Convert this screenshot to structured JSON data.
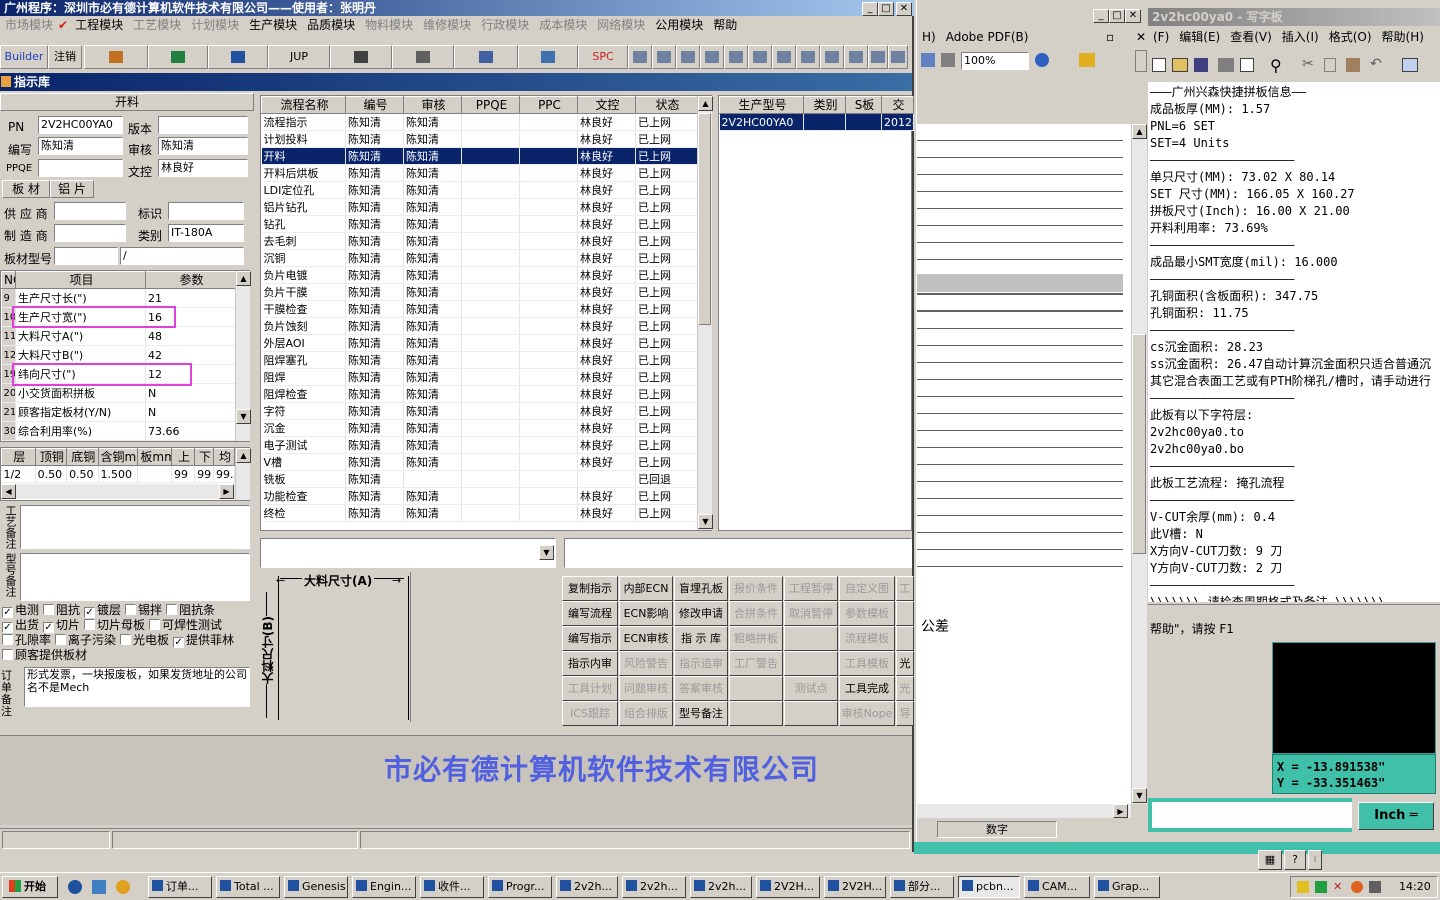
{
  "main": {
    "title": "广州程序：深圳市必有德计算机软件技术有限公司——使用者：张明丹",
    "menu": [
      "市场模块",
      "工程模块",
      "工艺模块",
      "计划模块",
      "生产模块",
      "品质模块",
      "物料模块",
      "维修模块",
      "行政模块",
      "成本模块",
      "网络模块",
      "公用模块",
      "帮助"
    ],
    "toolbar": [
      "Builder",
      "注销",
      "JUP",
      "SPC"
    ],
    "sub_title": "指示库"
  },
  "left": {
    "header": "开料",
    "pn_label": "PN",
    "pn": "2V2HC00YA0",
    "ver_label": "版本",
    "ver": "",
    "edit_label": "编写",
    "edit": "陈知清",
    "review_label": "审核",
    "review": "陈知清",
    "ppqe_label": "PPQE",
    "ppqe": "",
    "doc_label": "文控",
    "doc": "林良好",
    "tab1": "板 材",
    "tab2": "铝 片",
    "supplier_label": "供 应 商",
    "supplier": "",
    "mark_label": "标识",
    "mark": "",
    "maker_label": "制 造 商",
    "maker": "",
    "type_label": "类别",
    "type": "IT-180A",
    "model_label": "板材型号",
    "model": "",
    "model2": "/",
    "param_head": [
      "NO",
      "项目",
      "参数"
    ],
    "params": [
      [
        "9",
        "生产尺寸长(\")",
        "21"
      ],
      [
        "10",
        "生产尺寸宽(\")",
        "16"
      ],
      [
        "11",
        "大料尺寸A(\")",
        "48"
      ],
      [
        "12",
        "大料尺寸B(\")",
        "42"
      ],
      [
        "19",
        "纬向尺寸(\")",
        "12"
      ],
      [
        "20",
        "小交货面积拼板",
        "N"
      ],
      [
        "21",
        "顾客指定板材(Y/N)",
        "N"
      ],
      [
        "30",
        "综合利用率(%)",
        "73.66"
      ]
    ],
    "layer_head": [
      "层",
      "顶铜",
      "底铜",
      "含铜mm",
      "板mm",
      "上",
      "下",
      "均"
    ],
    "layer_row": [
      "1/2",
      "0.50",
      "0.50",
      "1.500",
      "",
      "99",
      "99",
      "99."
    ],
    "note_label1": "工艺备注",
    "note_label2": "型号备注",
    "checks": [
      [
        "电测",
        true
      ],
      [
        "阻抗",
        false
      ],
      [
        "镀层",
        true
      ],
      [
        "锡拌",
        false
      ],
      [
        "阻抗条",
        false
      ],
      [
        "出货",
        true
      ],
      [
        "切片",
        true
      ],
      [
        "切片母板",
        false
      ],
      [
        "可焊性测试",
        false
      ],
      [
        "孔隙率",
        false
      ],
      [
        "离子污染",
        false
      ],
      [
        "光电板",
        false
      ],
      [
        "提供菲林",
        true
      ],
      [
        "顾客提供板材",
        false
      ]
    ],
    "order_label": "订单备注",
    "order_note": "形式发票，一块报废板，如果发货地址的公司名不是Mech"
  },
  "flow": {
    "head": [
      "流程名称",
      "编号",
      "审核",
      "PPQE",
      "PPC",
      "文控",
      "状态"
    ],
    "rows": [
      [
        "流程指示",
        "陈知清",
        "陈知清",
        "",
        "",
        "林良好",
        "已上网"
      ],
      [
        "计划投料",
        "陈知清",
        "陈知清",
        "",
        "",
        "林良好",
        "已上网"
      ],
      [
        "开料",
        "陈知清",
        "陈知清",
        "",
        "",
        "林良好",
        "已上网"
      ],
      [
        "开料后烘板",
        "陈知清",
        "陈知清",
        "",
        "",
        "林良好",
        "已上网"
      ],
      [
        "LDI定位孔",
        "陈知清",
        "陈知清",
        "",
        "",
        "林良好",
        "已上网"
      ],
      [
        "铝片钻孔",
        "陈知清",
        "陈知清",
        "",
        "",
        "林良好",
        "已上网"
      ],
      [
        "钻孔",
        "陈知清",
        "陈知清",
        "",
        "",
        "林良好",
        "已上网"
      ],
      [
        "去毛刺",
        "陈知清",
        "陈知清",
        "",
        "",
        "林良好",
        "已上网"
      ],
      [
        "沉铜",
        "陈知清",
        "陈知清",
        "",
        "",
        "林良好",
        "已上网"
      ],
      [
        "负片电镀",
        "陈知清",
        "陈知清",
        "",
        "",
        "林良好",
        "已上网"
      ],
      [
        "负片干膜",
        "陈知清",
        "陈知清",
        "",
        "",
        "林良好",
        "已上网"
      ],
      [
        "干膜检查",
        "陈知清",
        "陈知清",
        "",
        "",
        "林良好",
        "已上网"
      ],
      [
        "负片蚀刻",
        "陈知清",
        "陈知清",
        "",
        "",
        "林良好",
        "已上网"
      ],
      [
        "外层AOI",
        "陈知清",
        "陈知清",
        "",
        "",
        "林良好",
        "已上网"
      ],
      [
        "阻焊塞孔",
        "陈知清",
        "陈知清",
        "",
        "",
        "林良好",
        "已上网"
      ],
      [
        "阻焊",
        "陈知清",
        "陈知清",
        "",
        "",
        "林良好",
        "已上网"
      ],
      [
        "阻焊检查",
        "陈知清",
        "陈知清",
        "",
        "",
        "林良好",
        "已上网"
      ],
      [
        "字符",
        "陈知清",
        "陈知清",
        "",
        "",
        "林良好",
        "已上网"
      ],
      [
        "沉金",
        "陈知清",
        "陈知清",
        "",
        "",
        "林良好",
        "已上网"
      ],
      [
        "电子测试",
        "陈知清",
        "陈知清",
        "",
        "",
        "林良好",
        "已上网"
      ],
      [
        "V槽",
        "陈知清",
        "陈知清",
        "",
        "",
        "林良好",
        "已上网"
      ],
      [
        "铣板",
        "陈知清",
        "",
        "",
        "",
        "",
        "已回退"
      ],
      [
        "功能检查",
        "陈知清",
        "陈知清",
        "",
        "",
        "林良好",
        "已上网"
      ],
      [
        "终检",
        "陈知清",
        "陈知清",
        "",
        "",
        "林良好",
        "已上网"
      ]
    ],
    "selected": 2
  },
  "prod": {
    "head": [
      "生产型号",
      "类别",
      "S板",
      "交"
    ],
    "row": [
      "2V2HC00YA0",
      "",
      "",
      "2012-"
    ]
  },
  "diagram": {
    "a": "大料尺寸(A)",
    "b": "大料尺寸(B)"
  },
  "buttons": [
    [
      "复制指示",
      1
    ],
    [
      "内部ECN",
      1
    ],
    [
      "盲埋孔板",
      1
    ],
    [
      "报价条件",
      0
    ],
    [
      "工程暂停",
      0
    ],
    [
      "自定义图",
      0
    ],
    [
      "工",
      0
    ],
    [
      "编写流程",
      1
    ],
    [
      "ECN影响",
      1
    ],
    [
      "修改申请",
      1
    ],
    [
      "合拼条件",
      0
    ],
    [
      "取消暂停",
      0
    ],
    [
      "参数模板",
      0
    ],
    [
      "",
      0
    ],
    [
      "编写指示",
      1
    ],
    [
      "ECN审核",
      1
    ],
    [
      "指 示 库",
      1
    ],
    [
      "粗略拼板",
      0
    ],
    [
      "",
      0
    ],
    [
      "流程模板",
      0
    ],
    [
      "",
      0
    ],
    [
      "指示内审",
      1
    ],
    [
      "风险警告",
      0
    ],
    [
      "指示追审",
      0
    ],
    [
      "工厂警告",
      0
    ],
    [
      "",
      0
    ],
    [
      "工具模板",
      0
    ],
    [
      "光",
      1
    ],
    [
      "工具计划",
      0
    ],
    [
      "问题审核",
      0
    ],
    [
      "答案审核",
      0
    ],
    [
      "",
      0
    ],
    [
      "测试点",
      0
    ],
    [
      "工具完成",
      1
    ],
    [
      "光",
      0
    ],
    [
      "ICS跟踪",
      0
    ],
    [
      "组合排版",
      0
    ],
    [
      "型号备注",
      1
    ],
    [
      "",
      0
    ],
    [
      "",
      0
    ],
    [
      "审核Nope",
      0
    ],
    [
      "导",
      0
    ]
  ],
  "banner": "市必有德计算机软件技术有限公司",
  "adobe": {
    "menu1": "H)",
    "menu2": "Adobe PDF(B)",
    "zoom": "100%",
    "status": "数字",
    "tolerance": "公差"
  },
  "wordpad": {
    "title": "2v2hc00ya0 - 写字板",
    "menu": [
      "(F)",
      "编辑(E)",
      "查看(V)",
      "插入(I)",
      "格式(O)",
      "帮助(H)"
    ],
    "lines": [
      "———广州兴森快捷拼板信息——",
      "成品板厚(MM): 1.57",
      "PNL=6 SET",
      "SET=4 Units",
      "————————————————————",
      "单只尺寸(MM): 73.02 X 80.14",
      "SET 尺寸(MM): 166.05 X 160.27",
      "拼板尺寸(Inch): 16.00 X 21.00",
      "开料利用率: 73.69%",
      "————————————————————",
      "成品最小SMT宽度(mil): 16.000",
      "————————————————————",
      "孔铜面积(含板面积): 347.75",
      "孔铜面积: 11.75",
      "————————————————————",
      "cs沉金面积: 28.23",
      "ss沉金面积: 26.47自动计算沉金面积只适合普通沉",
      "其它混合表面工艺或有PTH阶梯孔/槽时，请手动进行",
      "————————————————————",
      "此板有以下字符层:",
      "2v2hc00ya0.to",
      "2v2hc00ya0.bo",
      "————————————————————",
      "此板工艺流程: 掩孔流程",
      "————————————————————",
      "V-CUT余厚(mm): 0.4",
      "此V槽: N",
      "X方向V-CUT刀数: 9 刀",
      "Y方向V-CUT刀数: 2 刀",
      "————————————————————",
      "\\\\\\\\\\\\\\ 请检查周期格式及备注 \\\\\\\\\\\\\\"
    ],
    "status": "帮助\"，请按 F1"
  },
  "cad": {
    "x": "X = -13.891538\"",
    "y": "Y = -33.351463\"",
    "unit": "Inch"
  },
  "taskbar": {
    "start": "开始",
    "items": [
      "订单...",
      "Total ...",
      "Genesis",
      "Engin...",
      "收件...",
      "Progr...",
      "2v2h...",
      "2v2h...",
      "2v2h...",
      "2V2H...",
      "2V2H...",
      "部分...",
      "pcbn...",
      "CAM...",
      "Grap..."
    ],
    "active": 12,
    "clock": "14:20"
  }
}
